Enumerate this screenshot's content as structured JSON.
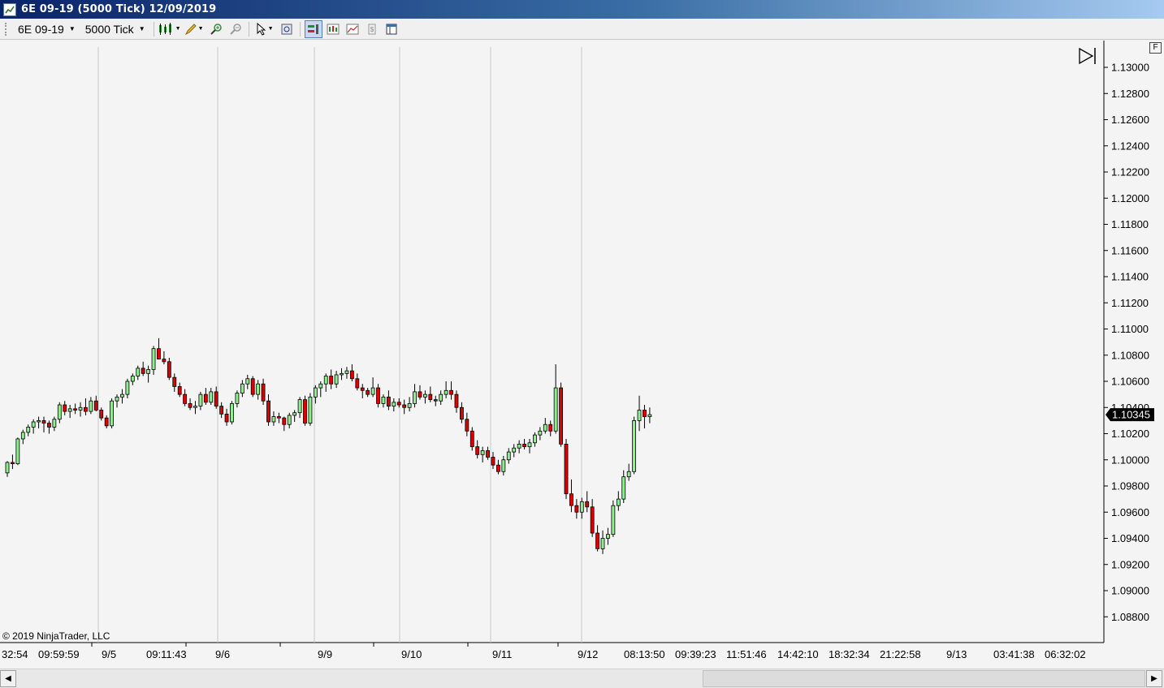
{
  "window": {
    "title": "6E 09-19 (5000 Tick)  12/09/2019"
  },
  "toolbar": {
    "instrument": "6E 09-19",
    "interval": "5000 Tick",
    "buttons": [
      "bar-style-icon",
      "draw-tool-pencil-icon",
      "zoom-in-icon",
      "zoom-out-icon",
      "pointer-icon",
      "properties-icon",
      "chart-trader-icon",
      "indicators-icon",
      "strategies-icon",
      "data-box-icon",
      "split-panel-icon"
    ]
  },
  "chart": {
    "copyright": "© 2019 NinjaTrader, LLC",
    "f_label": "F",
    "current_price": "1.10345",
    "colors": {
      "up": "#90ee90",
      "down": "#dd0000",
      "wick": "#000000",
      "grid": "#c8c8c8",
      "bg": "#f4f4f4"
    }
  },
  "chart_data": {
    "type": "candlestick",
    "title": "",
    "xlabel": "",
    "ylabel": "",
    "ylim": [
      1.0872,
      1.1318
    ],
    "y_ticks": [
      "1.13000",
      "1.12800",
      "1.12600",
      "1.12400",
      "1.12200",
      "1.12000",
      "1.11800",
      "1.11600",
      "1.11400",
      "1.11200",
      "1.11000",
      "1.10800",
      "1.10600",
      "1.10400",
      "1.10200",
      "1.10000",
      "1.09800",
      "1.09600",
      "1.09400",
      "1.09200",
      "1.09000",
      "1.08800"
    ],
    "x_ticks": [
      "32:54",
      "09:59:59",
      "9/5",
      "09:11:43",
      "9/6",
      "9/9",
      "9/10",
      "9/11",
      "9/12",
      "08:13:50",
      "09:39:23",
      "11:51:46",
      "14:42:10",
      "18:32:34",
      "21:22:58",
      "9/13",
      "03:41:38",
      "06:32:02"
    ],
    "session_breaks": [
      "9/5",
      "9/6",
      "9/9",
      "9/10",
      "9/11",
      "9/12"
    ],
    "last_price": 1.10345,
    "candles": [
      [
        1.099,
        1.0999,
        1.0987,
        1.0998
      ],
      [
        1.0998,
        1.1004,
        1.0993,
        1.0997
      ],
      [
        1.0997,
        1.1017,
        1.0996,
        1.1016
      ],
      [
        1.1016,
        1.1023,
        1.1012,
        1.1021
      ],
      [
        1.1021,
        1.1027,
        1.1018,
        1.1025
      ],
      [
        1.1025,
        1.1031,
        1.102,
        1.1029
      ],
      [
        1.1029,
        1.1033,
        1.1024,
        1.103
      ],
      [
        1.103,
        1.1033,
        1.1021,
        1.1028
      ],
      [
        1.1028,
        1.103,
        1.102,
        1.1025
      ],
      [
        1.1025,
        1.1033,
        1.1022,
        1.1031
      ],
      [
        1.1031,
        1.1044,
        1.1028,
        1.1042
      ],
      [
        1.1042,
        1.1045,
        1.1034,
        1.1037
      ],
      [
        1.1037,
        1.1042,
        1.1032,
        1.1039
      ],
      [
        1.1039,
        1.1043,
        1.1035,
        1.1038
      ],
      [
        1.1038,
        1.1044,
        1.1033,
        1.104
      ],
      [
        1.104,
        1.1047,
        1.1034,
        1.1037
      ],
      [
        1.1037,
        1.1048,
        1.1035,
        1.1045
      ],
      [
        1.1045,
        1.1049,
        1.1037,
        1.1038
      ],
      [
        1.1038,
        1.104,
        1.103,
        1.1032
      ],
      [
        1.1032,
        1.1034,
        1.1024,
        1.1026
      ],
      [
        1.1026,
        1.1047,
        1.1024,
        1.1045
      ],
      [
        1.1045,
        1.105,
        1.104,
        1.1048
      ],
      [
        1.1048,
        1.1054,
        1.1043,
        1.105
      ],
      [
        1.105,
        1.1062,
        1.1047,
        1.106
      ],
      [
        1.106,
        1.1066,
        1.1057,
        1.1064
      ],
      [
        1.1064,
        1.1072,
        1.1061,
        1.107
      ],
      [
        1.107,
        1.1075,
        1.1064,
        1.1066
      ],
      [
        1.1066,
        1.1072,
        1.1059,
        1.1069
      ],
      [
        1.1069,
        1.1087,
        1.1065,
        1.1085
      ],
      [
        1.1085,
        1.1093,
        1.1077,
        1.1077
      ],
      [
        1.1077,
        1.1083,
        1.1073,
        1.1075
      ],
      [
        1.1075,
        1.1078,
        1.1061,
        1.1063
      ],
      [
        1.1063,
        1.1066,
        1.1052,
        1.1056
      ],
      [
        1.1056,
        1.1059,
        1.1048,
        1.105
      ],
      [
        1.105,
        1.1054,
        1.1041,
        1.1043
      ],
      [
        1.1043,
        1.1047,
        1.1038,
        1.104
      ],
      [
        1.104,
        1.1045,
        1.1035,
        1.1041
      ],
      [
        1.1041,
        1.1052,
        1.1038,
        1.105
      ],
      [
        1.105,
        1.1055,
        1.1042,
        1.1044
      ],
      [
        1.1044,
        1.1055,
        1.1042,
        1.1052
      ],
      [
        1.1052,
        1.1056,
        1.1039,
        1.1041
      ],
      [
        1.1041,
        1.1044,
        1.1032,
        1.1035
      ],
      [
        1.1035,
        1.1039,
        1.1026,
        1.1029
      ],
      [
        1.1029,
        1.1045,
        1.1027,
        1.1043
      ],
      [
        1.1043,
        1.1053,
        1.104,
        1.1051
      ],
      [
        1.1051,
        1.1061,
        1.1048,
        1.1058
      ],
      [
        1.1058,
        1.1065,
        1.1054,
        1.1062
      ],
      [
        1.1062,
        1.1064,
        1.1048,
        1.105
      ],
      [
        1.105,
        1.1061,
        1.1046,
        1.1058
      ],
      [
        1.1058,
        1.1062,
        1.1042,
        1.1045
      ],
      [
        1.1045,
        1.105,
        1.1026,
        1.1029
      ],
      [
        1.1029,
        1.1037,
        1.1026,
        1.1033
      ],
      [
        1.1033,
        1.1036,
        1.1028,
        1.1032
      ],
      [
        1.1032,
        1.1033,
        1.1022,
        1.1027
      ],
      [
        1.1027,
        1.1036,
        1.1024,
        1.1034
      ],
      [
        1.1034,
        1.1038,
        1.1029,
        1.1036
      ],
      [
        1.1036,
        1.1048,
        1.1032,
        1.1046
      ],
      [
        1.1046,
        1.1049,
        1.1026,
        1.1028
      ],
      [
        1.1028,
        1.1051,
        1.1026,
        1.1048
      ],
      [
        1.1048,
        1.1057,
        1.1043,
        1.1055
      ],
      [
        1.1055,
        1.106,
        1.1048,
        1.1058
      ],
      [
        1.1058,
        1.1066,
        1.1052,
        1.1064
      ],
      [
        1.1064,
        1.1069,
        1.1054,
        1.1058
      ],
      [
        1.1058,
        1.1068,
        1.1055,
        1.1065
      ],
      [
        1.1065,
        1.107,
        1.1061,
        1.1066
      ],
      [
        1.1066,
        1.1071,
        1.1062,
        1.1068
      ],
      [
        1.1068,
        1.1073,
        1.106,
        1.1062
      ],
      [
        1.1062,
        1.1066,
        1.1053,
        1.1055
      ],
      [
        1.1055,
        1.1058,
        1.1047,
        1.1053
      ],
      [
        1.1053,
        1.1055,
        1.1048,
        1.105
      ],
      [
        1.105,
        1.1063,
        1.1048,
        1.1055
      ],
      [
        1.1055,
        1.1058,
        1.104,
        1.1043
      ],
      [
        1.1043,
        1.105,
        1.104,
        1.1048
      ],
      [
        1.1048,
        1.1053,
        1.1038,
        1.1041
      ],
      [
        1.1041,
        1.1047,
        1.1037,
        1.1044
      ],
      [
        1.1044,
        1.1047,
        1.104,
        1.1042
      ],
      [
        1.1042,
        1.1046,
        1.1035,
        1.104
      ],
      [
        1.104,
        1.1048,
        1.1037,
        1.1043
      ],
      [
        1.1043,
        1.1058,
        1.104,
        1.1052
      ],
      [
        1.1052,
        1.1057,
        1.1046,
        1.1048
      ],
      [
        1.1048,
        1.1053,
        1.1043,
        1.105
      ],
      [
        1.105,
        1.1056,
        1.1044,
        1.1046
      ],
      [
        1.1046,
        1.1049,
        1.1041,
        1.1045
      ],
      [
        1.1045,
        1.1053,
        1.1042,
        1.105
      ],
      [
        1.105,
        1.106,
        1.1047,
        1.1053
      ],
      [
        1.1053,
        1.106,
        1.1046,
        1.105
      ],
      [
        1.105,
        1.1053,
        1.1036,
        1.104
      ],
      [
        1.104,
        1.1044,
        1.1028,
        1.1031
      ],
      [
        1.1031,
        1.1036,
        1.1018,
        1.1022
      ],
      [
        1.1022,
        1.1025,
        1.1007,
        1.101
      ],
      [
        1.101,
        1.1015,
        1.1001,
        1.1004
      ],
      [
        1.1004,
        1.101,
        1.0998,
        1.1007
      ],
      [
        1.1007,
        1.101,
        1.1,
        1.1002
      ],
      [
        1.1002,
        1.1006,
        1.0993,
        1.0996
      ],
      [
        1.0996,
        1.1,
        1.0989,
        1.0991
      ],
      [
        1.0991,
        1.1003,
        1.0988,
        1.1
      ],
      [
        1.1,
        1.1009,
        1.0997,
        1.1006
      ],
      [
        1.1006,
        1.1012,
        1.1002,
        1.1009
      ],
      [
        1.1009,
        1.1015,
        1.1005,
        1.1012
      ],
      [
        1.1012,
        1.1016,
        1.1008,
        1.101
      ],
      [
        1.101,
        1.1016,
        1.1005,
        1.1013
      ],
      [
        1.1013,
        1.1021,
        1.101,
        1.1019
      ],
      [
        1.1019,
        1.1025,
        1.1015,
        1.1022
      ],
      [
        1.1022,
        1.1032,
        1.102,
        1.1027
      ],
      [
        1.1027,
        1.103,
        1.1018,
        1.1022
      ],
      [
        1.1022,
        1.1073,
        1.102,
        1.1055
      ],
      [
        1.1055,
        1.1059,
        1.101,
        1.1012
      ],
      [
        1.1012,
        1.1016,
        1.097,
        1.0974
      ],
      [
        1.0974,
        1.0985,
        1.096,
        1.0965
      ],
      [
        1.0965,
        1.097,
        1.0955,
        1.096
      ],
      [
        1.096,
        1.0971,
        1.0955,
        1.0968
      ],
      [
        1.0968,
        1.0976,
        1.096,
        1.0964
      ],
      [
        1.0964,
        1.097,
        1.0941,
        1.0944
      ],
      [
        1.0944,
        1.095,
        1.093,
        1.0932
      ],
      [
        1.0932,
        1.0946,
        1.0928,
        1.094
      ],
      [
        1.094,
        1.0948,
        1.0935,
        1.0943
      ],
      [
        1.0943,
        1.0969,
        1.0941,
        1.0965
      ],
      [
        1.0965,
        1.0976,
        1.0961,
        1.097
      ],
      [
        1.097,
        1.0992,
        1.0967,
        1.0987
      ],
      [
        1.0987,
        1.0997,
        1.0984,
        1.0991
      ],
      [
        1.0991,
        1.1033,
        1.0989,
        1.103
      ],
      [
        1.103,
        1.1049,
        1.1022,
        1.1038
      ],
      [
        1.1038,
        1.1042,
        1.1024,
        1.1033
      ],
      [
        1.1033,
        1.104,
        1.1028,
        1.10345
      ]
    ]
  }
}
